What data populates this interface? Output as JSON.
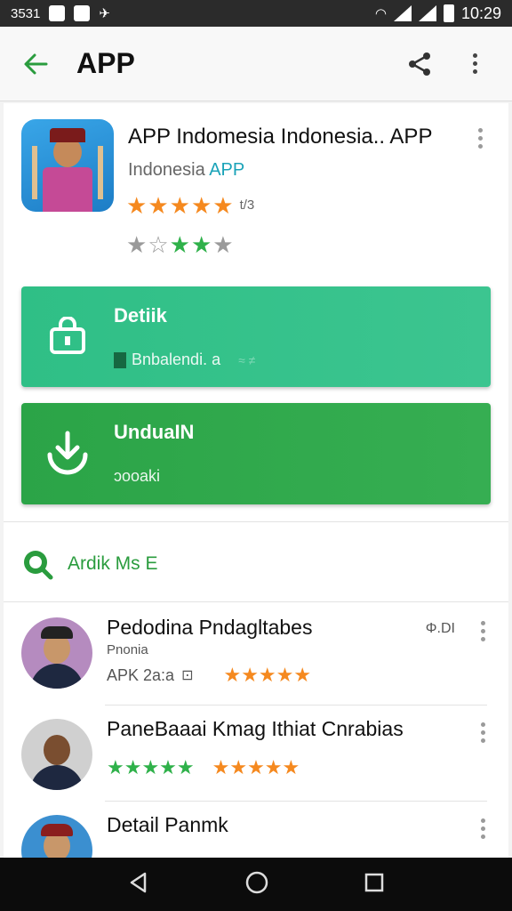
{
  "status_bar": {
    "time_left": "3531",
    "time_right": "10:29"
  },
  "app_bar": {
    "title": "APP"
  },
  "header": {
    "app_title": "APP Indomesia Indonesia.. APP",
    "subtitle_main": "Indonesia",
    "subtitle_tag": "APP",
    "rating_small": "t/3",
    "stars_row1": [
      "★",
      "★",
      "★",
      "★",
      "★"
    ],
    "stars_row2": [
      "★",
      "☆",
      "★",
      "★",
      "★"
    ]
  },
  "detail_card": {
    "label": "Detiik",
    "meta": "Bnbalendi. a",
    "meta_faint": "≈ ≠"
  },
  "download_card": {
    "label": "UnduaIN",
    "meta": "ɔooaki"
  },
  "section": {
    "label": "Ardik Ms E"
  },
  "list": [
    {
      "name": "Pedodina Pndagltabes",
      "sub": "Pnonia",
      "row_text": "APK 2a:a",
      "count": "Φ.DI",
      "stars_a": "★★★★★",
      "stars_b": ""
    },
    {
      "name": "PaneBaaai Kmag Ithiat Cnrabias",
      "sub": "",
      "row_text": "",
      "count": "",
      "stars_a": "★★★★★",
      "stars_b": "★★★★★"
    },
    {
      "name": "Detail Panmk",
      "sub": "",
      "row_text": "",
      "count": "",
      "stars_a": "",
      "stars_b": ""
    }
  ],
  "colors": {
    "detail_green": "#34c18a",
    "download_green": "#2fa84c",
    "star_orange": "#f5891f",
    "star_green": "#2fb14a",
    "accent_green": "#2a9c3e"
  }
}
